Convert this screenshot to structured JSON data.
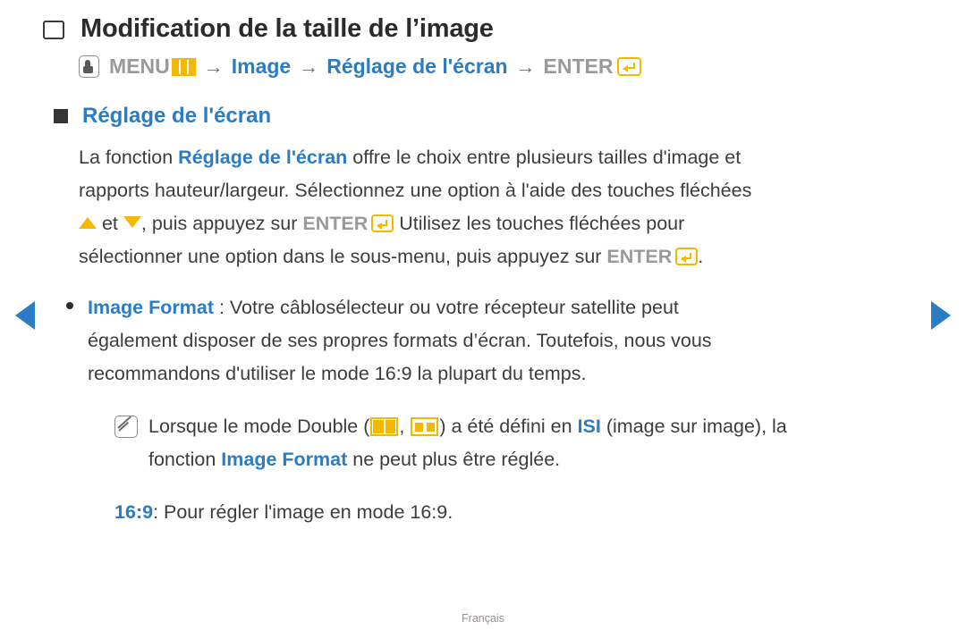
{
  "page": {
    "title": "Modification de la taille de l’image",
    "footer_language": "Français"
  },
  "menu_path": {
    "pointer_icon": "hand-pointer-icon",
    "menu_label": "MENU",
    "menu_icon": "menu-grid-icon",
    "arrow": "→",
    "step_image": "Image",
    "step_screen_adjust": "Réglage de l'écran",
    "enter_label": "ENTER",
    "enter_icon": "enter-key-icon"
  },
  "section": {
    "heading": "Réglage de l'écran",
    "paragraph": {
      "line1_a": "La fonction ",
      "line1_b": "Réglage de l'écran",
      "line1_c": " offre le choix entre plusieurs tailles d'image et",
      "line2": "rapports hauteur/largeur. Sélectionnez une option à l'aide des touches fléchées",
      "line3_a": " et ",
      "line3_b": ", puis appuyez sur ",
      "line3_c": "ENTER",
      "line3_d": " Utilisez les touches fléchées pour",
      "line4_a": "sélectionner une option dans le sous-menu, puis appuyez sur ",
      "line4_b": "ENTER",
      "line4_c": "."
    }
  },
  "bullet": {
    "term": "Image Format",
    "line1_rest": " : Votre câblosélecteur ou votre récepteur satellite peut",
    "line2": "également disposer de ses propres formats d’écran. Toutefois, nous vous",
    "line3": "recommandons d'utiliser le mode 16:9 la plupart du temps."
  },
  "note": {
    "icon": "note-pencil-icon",
    "line1_a": "Lorsque le mode Double (",
    "icon_double_full": "double-mode-full-icon",
    "line1_b": ", ",
    "icon_double_split": "double-mode-split-icon",
    "line1_c": ") a été défini en ",
    "line1_highlight": "ISI",
    "line1_d": " (image sur image), la",
    "line2_a": "fonction ",
    "line2_b": "Image Format",
    "line2_c": " ne peut plus être réglée."
  },
  "sub_entry": {
    "term": "16:9",
    "text": ": Pour régler l'image en mode 16:9."
  },
  "nav": {
    "prev_icon": "previous-page-arrow",
    "next_icon": "next-page-arrow"
  },
  "colors": {
    "blue": "#2b7cc4",
    "yellow": "#f5b800",
    "gray": "#9a9a9a",
    "text": "#3d3d3d"
  }
}
